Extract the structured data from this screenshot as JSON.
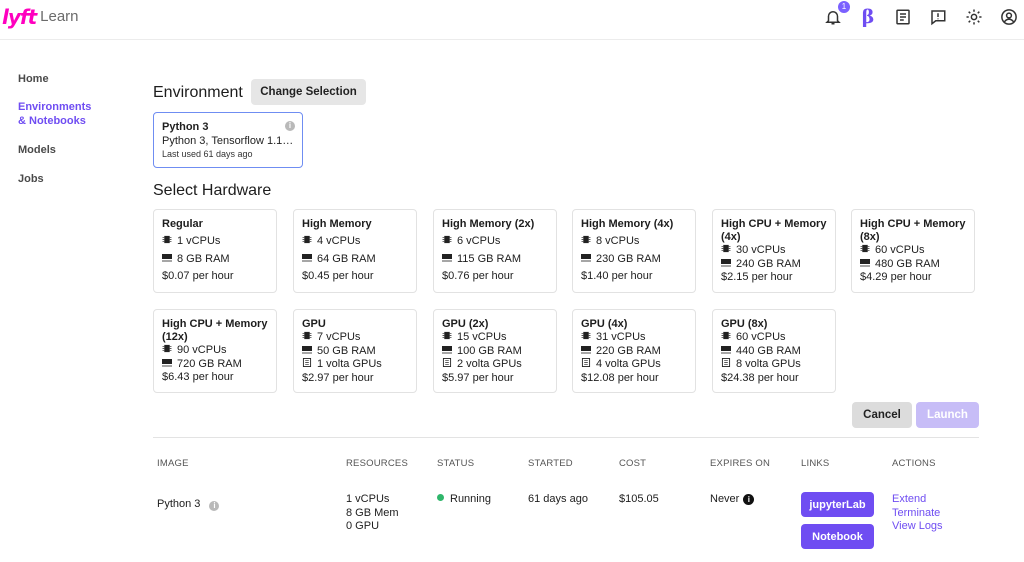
{
  "app": {
    "logo_mark": "lyft",
    "logo_text": "Learn"
  },
  "topbar": {
    "notification_count": "1",
    "beta_label": "β",
    "icons": [
      "bell-icon",
      "beta-icon",
      "docs-icon",
      "feedback-icon",
      "gear-icon",
      "user-icon"
    ]
  },
  "sidebar": {
    "items": [
      {
        "label": "Home",
        "active": false
      },
      {
        "label": "Environments & Notebooks",
        "active": true
      },
      {
        "label": "Models",
        "active": false
      },
      {
        "label": "Jobs",
        "active": false
      }
    ]
  },
  "environment": {
    "title": "Environment",
    "change_label": "Change Selection",
    "card": {
      "name": "Python 3",
      "description": "Python 3, Tensorflow 1.14....",
      "last_used": "Last used 61 days ago",
      "info_glyph": "i"
    }
  },
  "hardware": {
    "title": "Select Hardware",
    "cards": [
      {
        "name": "Regular",
        "cpu": "1 vCPUs",
        "ram": "8 GB RAM",
        "gpu": "",
        "price": "$0.07 per hour"
      },
      {
        "name": "High Memory",
        "cpu": "4 vCPUs",
        "ram": "64 GB RAM",
        "gpu": "",
        "price": "$0.45 per hour"
      },
      {
        "name": "High Memory (2x)",
        "cpu": "6 vCPUs",
        "ram": "115 GB RAM",
        "gpu": "",
        "price": "$0.76 per hour"
      },
      {
        "name": "High Memory (4x)",
        "cpu": "8 vCPUs",
        "ram": "230 GB RAM",
        "gpu": "",
        "price": "$1.40 per hour"
      },
      {
        "name": "High CPU + Memory (4x)",
        "cpu": "30 vCPUs",
        "ram": "240 GB RAM",
        "gpu": "",
        "price": "$2.15 per hour"
      },
      {
        "name": "High CPU + Memory (8x)",
        "cpu": "60 vCPUs",
        "ram": "480 GB RAM",
        "gpu": "",
        "price": "$4.29 per hour"
      },
      {
        "name": "High CPU + Memory (12x)",
        "cpu": "90 vCPUs",
        "ram": "720 GB RAM",
        "gpu": "",
        "price": "$6.43 per hour"
      },
      {
        "name": "GPU",
        "cpu": "7 vCPUs",
        "ram": "50 GB RAM",
        "gpu": "1 volta GPUs",
        "price": "$2.97 per hour"
      },
      {
        "name": "GPU (2x)",
        "cpu": "15 vCPUs",
        "ram": "100 GB RAM",
        "gpu": "2 volta GPUs",
        "price": "$5.97 per hour"
      },
      {
        "name": "GPU (4x)",
        "cpu": "31 vCPUs",
        "ram": "220 GB RAM",
        "gpu": "4 volta GPUs",
        "price": "$12.08 per hour"
      },
      {
        "name": "GPU (8x)",
        "cpu": "60 vCPUs",
        "ram": "440 GB RAM",
        "gpu": "8 volta GPUs",
        "price": "$24.38 per hour"
      }
    ]
  },
  "actions": {
    "cancel_label": "Cancel",
    "launch_label": "Launch"
  },
  "table": {
    "headers": {
      "image": "IMAGE",
      "resources": "RESOURCES",
      "status": "STATUS",
      "started": "STARTED",
      "cost": "COST",
      "expires": "EXPIRES ON",
      "links": "LINKS",
      "actions": "ACTIONS"
    },
    "row": {
      "image": "Python 3",
      "resources_cpu": "1 vCPUs",
      "resources_mem": "8 GB Mem",
      "resources_gpu": "0 GPU",
      "status": "Running",
      "started": "61 days ago",
      "cost": "$105.05",
      "expires": "Never",
      "links": {
        "jupyter": "jupyterLab",
        "notebook": "Notebook"
      },
      "actions": {
        "extend": "Extend",
        "terminate": "Terminate",
        "view_logs": "View Logs"
      }
    }
  },
  "colors": {
    "accent": "#6f4df2",
    "brand": "#ff00bf",
    "running": "#2fb66b",
    "launch_disabled": "#c7bdf7"
  }
}
